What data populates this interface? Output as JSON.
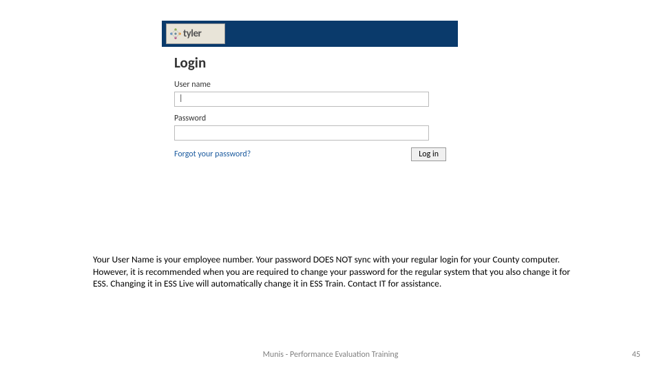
{
  "header": {
    "logo_text": "tyler"
  },
  "login": {
    "title": "Login",
    "username_label": "User name",
    "username_value": "|",
    "password_label": "Password",
    "password_value": "",
    "forgot_link": "Forgot your password?",
    "login_button": "Log in"
  },
  "instructions": {
    "text": "Your User Name is your employee number.  Your password DOES NOT sync with your regular login for your County computer.  However, it is recommended when you are required to change your password for the regular system that you also change it for ESS.  Changing it in ESS Live will automatically change it in ESS Train.  Contact IT for assistance."
  },
  "footer": {
    "title": "Munis - Performance Evaluation Training",
    "page": "45"
  }
}
